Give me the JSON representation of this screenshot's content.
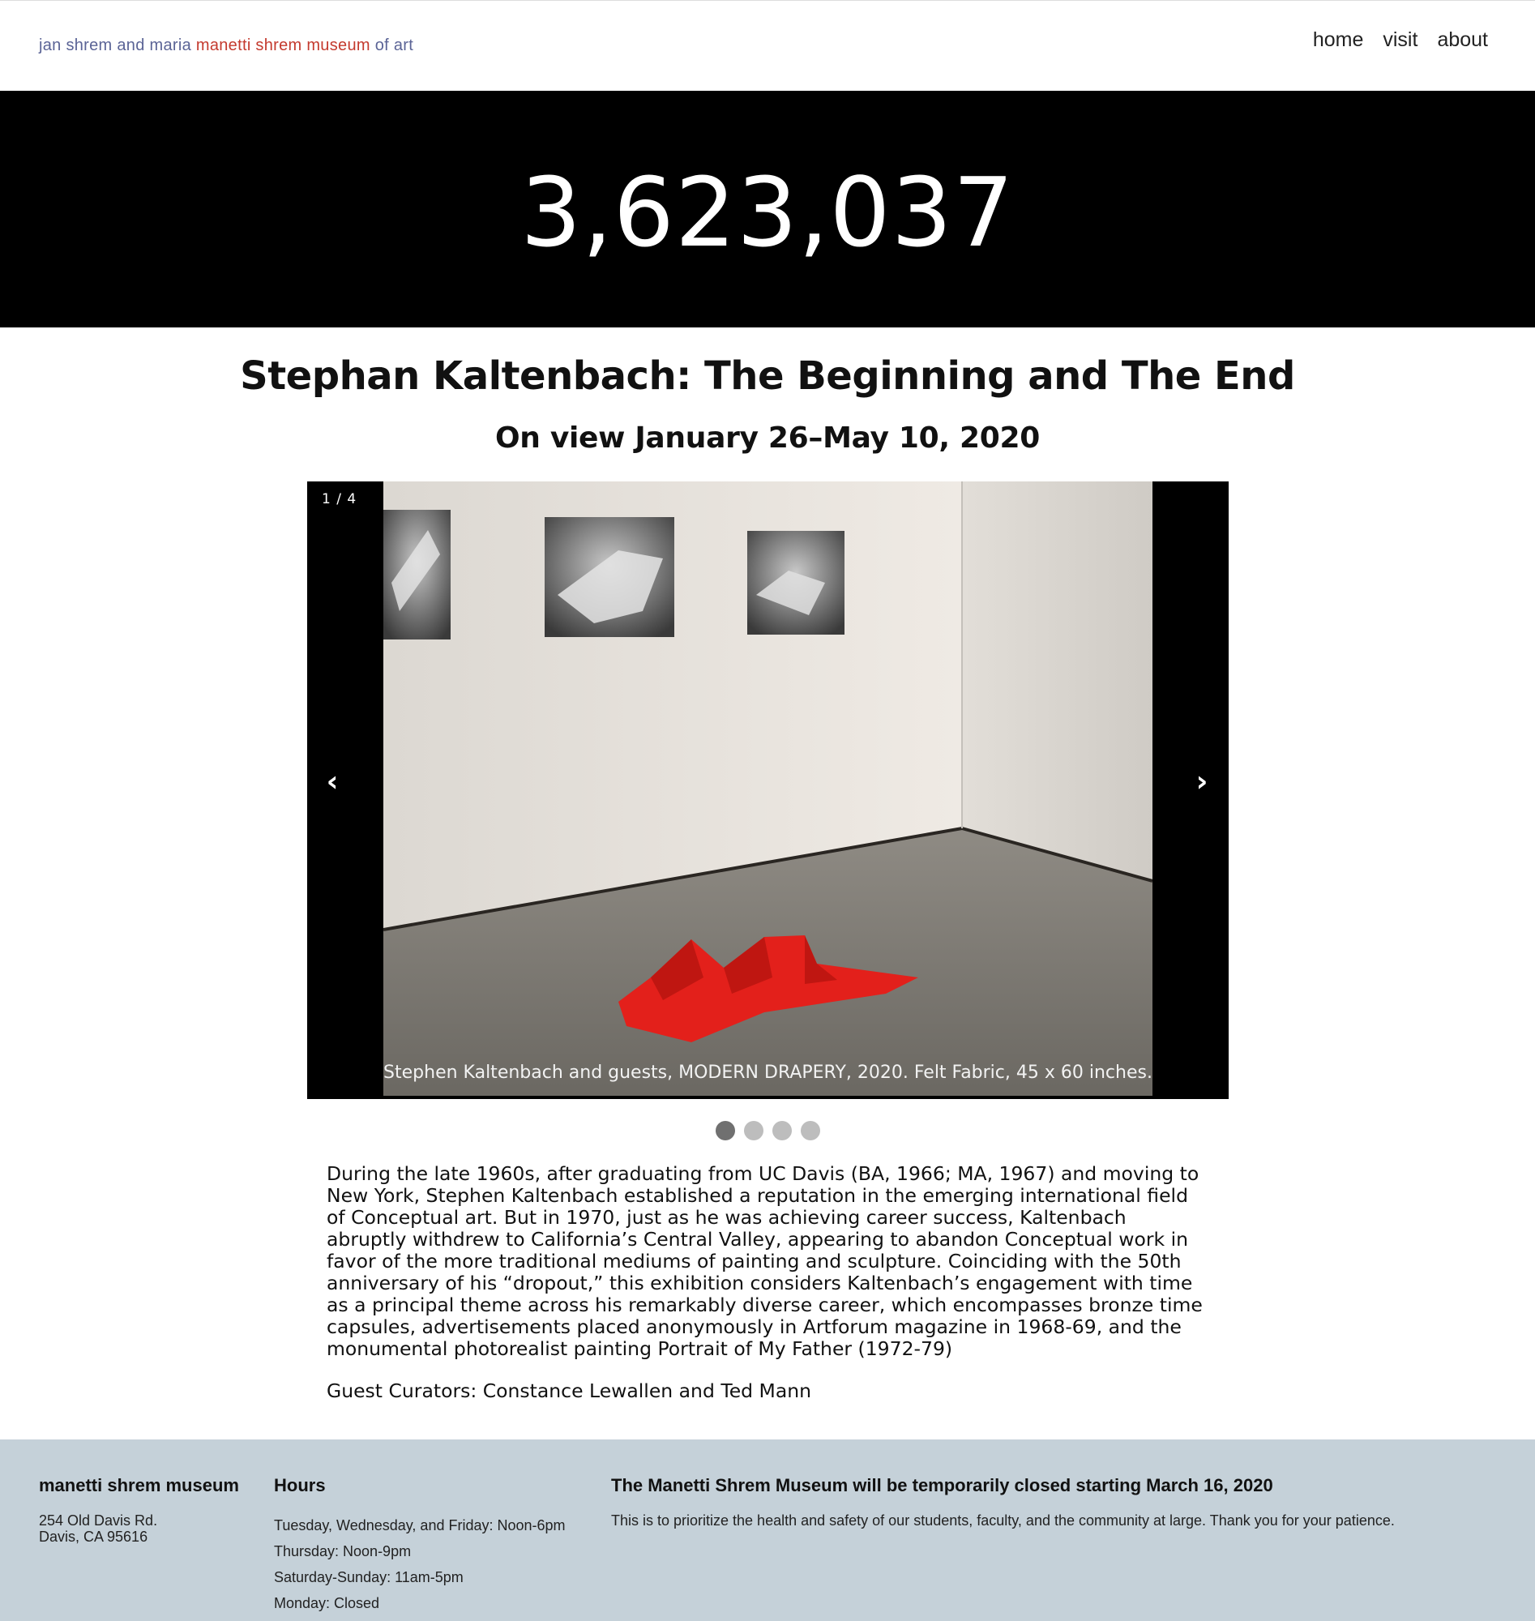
{
  "header": {
    "logo_prefix": "jan shrem and maria ",
    "logo_brand": "manetti shrem museum",
    "logo_suffix": " of art",
    "nav": [
      {
        "label": "home"
      },
      {
        "label": "visit"
      },
      {
        "label": "about"
      }
    ]
  },
  "counter": "3,623,037",
  "exhibition": {
    "title": "Stephan Kaltenbach: The Beginning and The End",
    "dates": "On view January 26–May 10, 2020"
  },
  "slider": {
    "counter": "1 / 4",
    "prev_icon": "‹",
    "next_icon": "›",
    "caption": "Stephen Kaltenbach and guests, MODERN DRAPERY, 2020. Felt Fabric, 45 x 60 inches.",
    "total": 4,
    "active_index": 0
  },
  "description": "During the late 1960s, after graduating from UC Davis (BA, 1966; MA, 1967) and moving to New York, Stephen Kaltenbach established a reputation in the emerging international field of Conceptual art. But in 1970, just as he was achieving career success, Kaltenbach abruptly withdrew to California’s Central Valley, appearing to abandon Conceptual work in favor of the more traditional mediums of painting and sculpture. Coinciding with the 50th anniversary of his “dropout,” this exhibition considers Kaltenbach’s engagement with time as a principal theme across his remarkably diverse career, which encompasses bronze time capsules, advertisements placed anonymously in Artforum magazine in 1968-69, and the monumental photorealist painting Portrait of My Father (1972-79)",
  "curators": "Guest Curators: Constance Lewallen and Ted Mann",
  "footer": {
    "museum": {
      "heading": "manetti shrem museum",
      "address_line1": "254 Old Davis Rd.",
      "address_line2": "Davis, CA 95616"
    },
    "hours": {
      "heading": "Hours",
      "lines": [
        "Tuesday, Wednesday, and Friday: Noon-6pm",
        "Thursday: Noon-9pm",
        "Saturday-Sunday: 11am-5pm",
        "Monday: Closed"
      ]
    },
    "notice": {
      "heading": "The Manetti Shrem Museum will be temporarily closed starting March 16, 2020",
      "text": "This is to prioritize the health and safety of our students, faculty, and the community at large. Thank you for your patience."
    }
  },
  "colors": {
    "accent": "#c43a2e",
    "logo_muted": "#5b6496",
    "footer_bg": "#c5d1d9",
    "felt_red": "#e3201b"
  }
}
